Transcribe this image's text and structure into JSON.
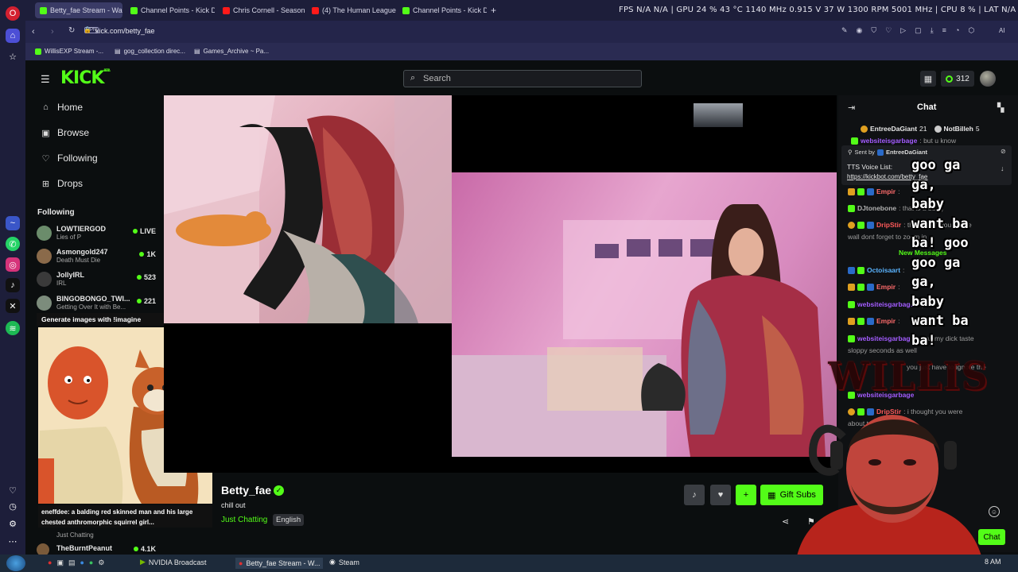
{
  "browser": {
    "tabs": [
      {
        "label": "Betty_fae Stream - Wa",
        "active": true
      },
      {
        "label": "Channel Points - Kick Das"
      },
      {
        "label": "Chris Cornell - Seasons (w"
      },
      {
        "label": "(4) The Human League - D"
      },
      {
        "label": "Channel Points - Kick Das"
      }
    ],
    "new_tab": "+",
    "url": "kick.com/betty_fae",
    "vpn": "VPN",
    "hud": "FPS N/A N/A | GPU 24 % 43 °C 1140 MHz 0.915 V 37 W 1300 RPM 5001 MHz | CPU 8 % | LAT N/A N/A",
    "bookmarks": [
      "WillisEXP Stream -...",
      "gog_collection direc...",
      "Games_Archive ~ Pa..."
    ],
    "ai_label": "AI"
  },
  "kick": {
    "logo": "KICK",
    "logo_sup": "BETA",
    "search_placeholder": "Search",
    "points": "312",
    "nav": [
      {
        "icon": "home-icon",
        "label": "Home"
      },
      {
        "icon": "browse-icon",
        "label": "Browse"
      },
      {
        "icon": "heart-icon",
        "label": "Following"
      },
      {
        "icon": "gift-icon",
        "label": "Drops"
      }
    ],
    "following_header": "Following",
    "following": [
      {
        "name": "LOWTIERGOD",
        "sub": "Lies of P",
        "count": "LIVE",
        "color": "#6b8c6b"
      },
      {
        "name": "Asmongold247",
        "sub": "Death Must Die",
        "count": "1K",
        "color": "#8a6a4a"
      },
      {
        "name": "JollyIRL",
        "sub": "IRL",
        "count": "523",
        "color": "#3a3a3a"
      },
      {
        "name": "BINGOBONGO_TWI...",
        "sub": "Getting Over It with Be...",
        "count": "221",
        "color": "#7c8c7c"
      }
    ],
    "imagine_title": "Generate images with !imagine",
    "imagine_caption": "eneffdee: a balding red skinned man and his large chested anthromorphic squirrel girl...",
    "bottom_category": "Just Chatting",
    "bottom_follow": {
      "name": "TheBurntPeanut",
      "count": "4.1K"
    },
    "streamer": {
      "name": "Betty_fae",
      "title": "chill out",
      "category": "Just Chatting",
      "language": "English"
    },
    "gift_subs": "Gift Subs",
    "chat_title": "Chat",
    "chat_send": "Chat",
    "pinned_top": [
      {
        "name": "EntreeDaGiant",
        "count": "21"
      },
      {
        "name": "NotBilleh",
        "count": "5"
      }
    ],
    "pinned": {
      "sent_by": "Sent by",
      "sender": "EntreeDaGiant",
      "text": "TTS Voice List:",
      "link": "https://kickbot.com/betty_fae"
    },
    "chat_lines": [
      {
        "user": "websiteisgarbage",
        "text": ": but u know",
        "color": "#a35cff"
      },
      {
        "user": "Empir",
        "text": ": ",
        "color": "#ff6b6b"
      },
      {
        "user": "DJtonebone",
        "text": ": that is a bung",
        "color": "#b0b0b0"
      },
      {
        "user": "DripStir",
        "text": ": then when you hit the",
        "color": "#ff5a5a"
      },
      {
        "user": "",
        "text": "wall dont forget to zoom in",
        "color": "#9c9c9c"
      },
      {
        "user": "New Messages",
        "text": "",
        "color": "#53fc18"
      },
      {
        "user": "Octoisaart",
        "text": ": ",
        "color": "#5ab4ff"
      },
      {
        "user": "Empir",
        "text": ": ",
        "color": "#ff6b6b"
      },
      {
        "user": "websiteisgarbage",
        "text": ": :)",
        "color": "#a35cff"
      },
      {
        "user": "Empir",
        "text": ": ",
        "color": "#ff6b6b"
      },
      {
        "user": "websiteisgarbage",
        "text": ": now my dick taste",
        "color": "#a35cff"
      },
      {
        "user": "",
        "text": "sloppy seconds as well",
        "color": "#9c9c9c"
      },
      {
        "user": "",
        "text": "you just have to ignore the",
        "color": "#9c9c9c"
      },
      {
        "user": "websiteisgarbage",
        "text": "",
        "color": "#a35cff"
      },
      {
        "user": "DripStir",
        "text": ": i thought you were",
        "color": "#ff5a5a"
      },
      {
        "user": "",
        "text": "about to take a bite",
        "color": "#9c9c9c"
      }
    ],
    "overlay_text": "goo ga ga, baby want ba ba! goo goo ga ga, baby want ba ba!",
    "overlay_lines": [
      "goo ga",
      "ga,",
      "baby",
      "want ba",
      "ba! goo",
      "goo ga",
      "ga,",
      "baby",
      "want ba",
      "ba!"
    ],
    "willis_logo": "WILLIS"
  },
  "taskbar": {
    "items": [
      "NVIDIA Broadcast",
      "Betty_fae Stream - W...",
      "Steam"
    ],
    "clock": "8 AM"
  }
}
